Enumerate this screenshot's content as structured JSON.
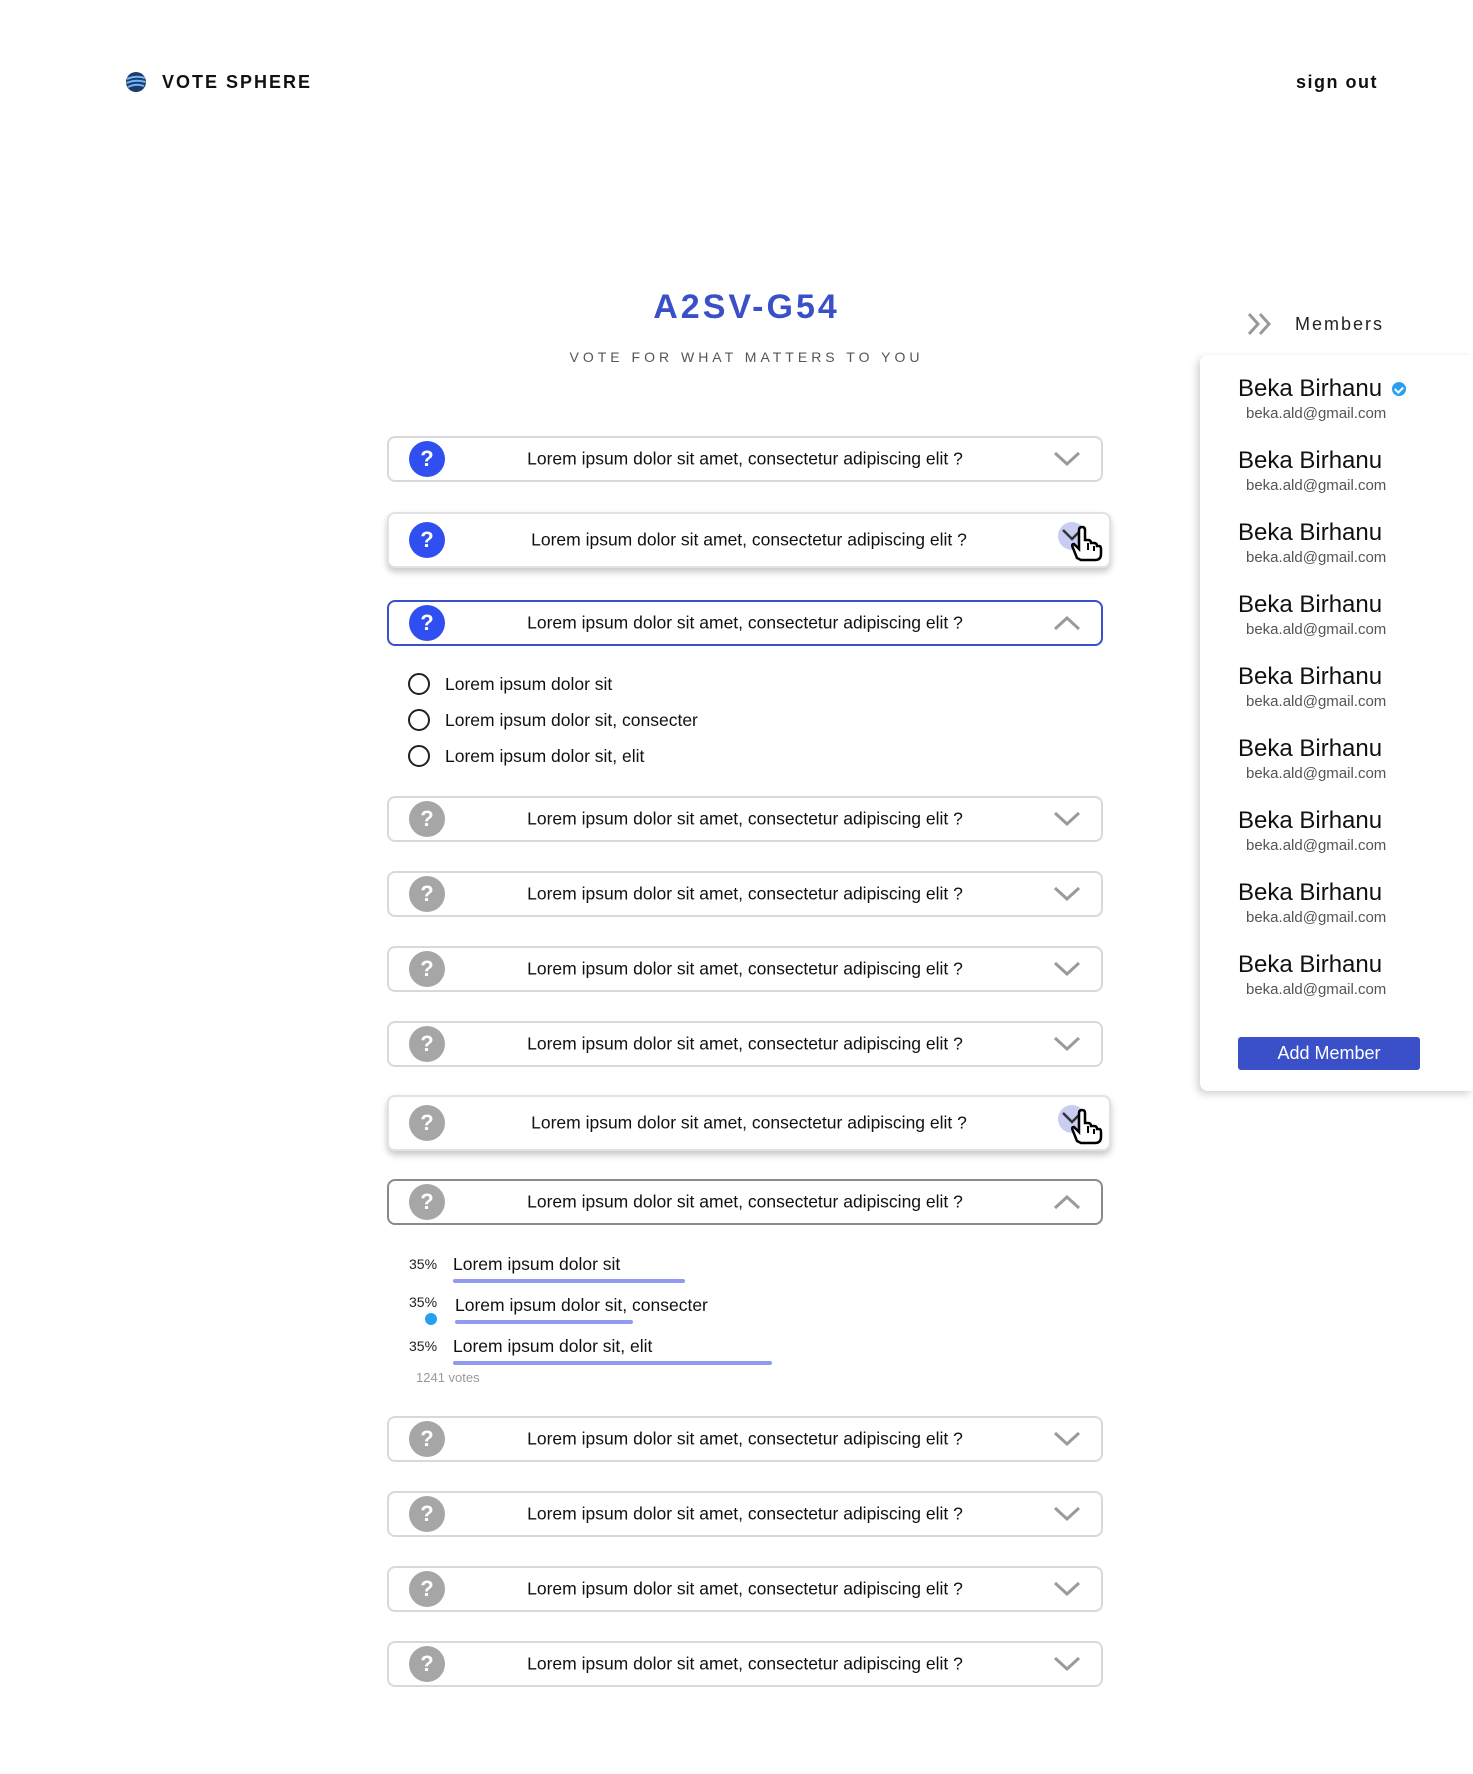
{
  "header": {
    "brand": "VOTE SPHERE",
    "sign_out": "sign out"
  },
  "group": {
    "title": "A2SV-G54",
    "tagline": "VOTE FOR WHAT MATTERS TO YOU"
  },
  "colors": {
    "accent": "#3a50c8",
    "active_question": "#2f4ff0",
    "inactive_question": "#a6a6a6",
    "result_bar": "#8f9af0",
    "verified": "#27a0f0"
  },
  "polls": [
    {
      "question": "Lorem ipsum dolor sit amet, consectetur adipiscing elit ?",
      "state": "collapsed"
    },
    {
      "question": "Lorem ipsum dolor sit amet, consectetur adipiscing elit ?",
      "state": "hover"
    },
    {
      "question": "Lorem ipsum dolor sit amet, consectetur adipiscing elit ?",
      "state": "expanded"
    },
    {
      "question": "Lorem ipsum dolor sit amet, consectetur adipiscing elit ?",
      "state": "collapsed"
    },
    {
      "question": "Lorem ipsum dolor sit amet, consectetur adipiscing elit ?",
      "state": "collapsed"
    },
    {
      "question": "Lorem ipsum dolor sit amet, consectetur adipiscing elit ?",
      "state": "collapsed"
    },
    {
      "question": "Lorem ipsum dolor sit amet, consectetur adipiscing elit ?",
      "state": "collapsed"
    },
    {
      "question": "Lorem ipsum dolor sit amet, consectetur adipiscing elit ?",
      "state": "hover"
    },
    {
      "question": "Lorem ipsum dolor sit amet, consectetur adipiscing elit ?",
      "state": "expanded-results"
    },
    {
      "question": "Lorem ipsum dolor sit amet, consectetur adipiscing elit ?",
      "state": "collapsed"
    },
    {
      "question": "Lorem ipsum dolor sit amet, consectetur adipiscing elit ?",
      "state": "collapsed"
    },
    {
      "question": "Lorem ipsum dolor sit amet, consectetur adipiscing elit ?",
      "state": "collapsed"
    },
    {
      "question": "Lorem ipsum dolor sit amet, consectetur adipiscing elit ?",
      "state": "collapsed"
    }
  ],
  "vote_options": [
    {
      "label": "Lorem ipsum dolor sit"
    },
    {
      "label": "Lorem ipsum dolor sit, consecter"
    },
    {
      "label": "Lorem ipsum dolor sit, elit"
    }
  ],
  "results": [
    {
      "percent": "35%",
      "label": "Lorem ipsum dolor sit",
      "bar_fill": 0.43,
      "selected": false
    },
    {
      "percent": "35%",
      "label": "Lorem ipsum dolor sit, consecter",
      "bar_fill": 0.33,
      "selected": true
    },
    {
      "percent": "35%",
      "label": "Lorem ipsum dolor sit, elit",
      "bar_fill": 0.59,
      "selected": false
    }
  ],
  "votes_text": "1241 votes",
  "members": {
    "title": "Members",
    "add_button": "Add Member",
    "list": [
      {
        "name": "Beka Birhanu",
        "email": "beka.ald@gmail.com",
        "verified": true
      },
      {
        "name": "Beka Birhanu",
        "email": "beka.ald@gmail.com",
        "verified": false
      },
      {
        "name": "Beka Birhanu",
        "email": "beka.ald@gmail.com",
        "verified": false
      },
      {
        "name": "Beka Birhanu",
        "email": "beka.ald@gmail.com",
        "verified": false
      },
      {
        "name": "Beka Birhanu",
        "email": "beka.ald@gmail.com",
        "verified": false
      },
      {
        "name": "Beka Birhanu",
        "email": "beka.ald@gmail.com",
        "verified": false
      },
      {
        "name": "Beka Birhanu",
        "email": "beka.ald@gmail.com",
        "verified": false
      },
      {
        "name": "Beka Birhanu",
        "email": "beka.ald@gmail.com",
        "verified": false
      },
      {
        "name": "Beka Birhanu",
        "email": "beka.ald@gmail.com",
        "verified": false
      }
    ]
  }
}
